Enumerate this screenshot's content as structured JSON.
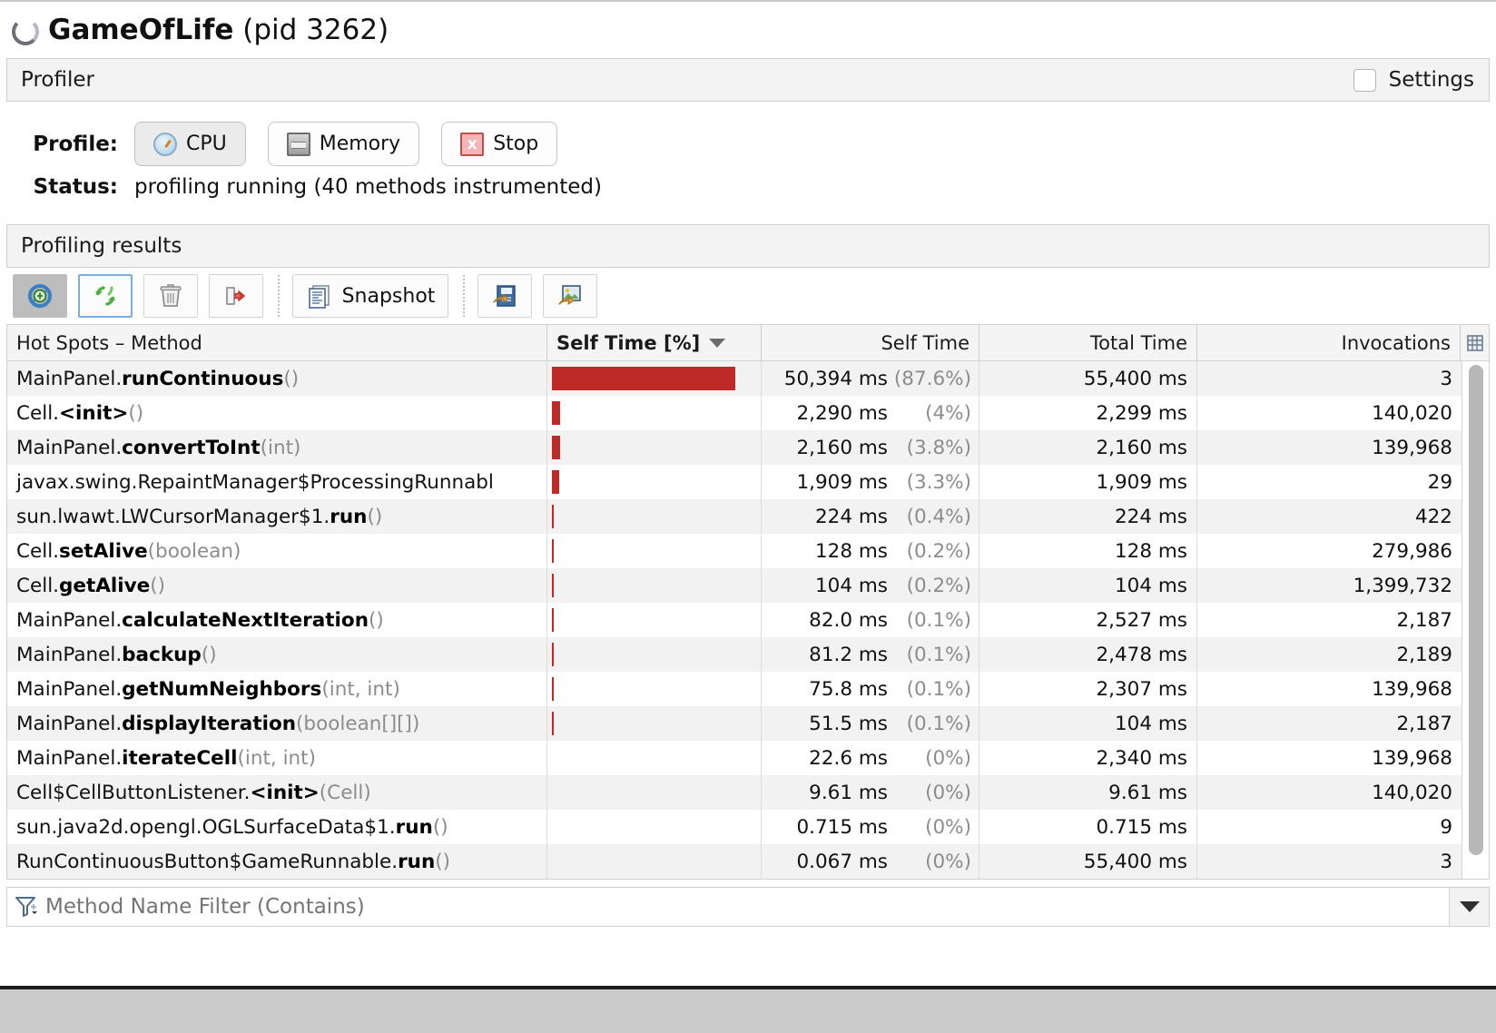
{
  "window": {
    "app_name": "GameOfLife",
    "pid_text": "(pid 3262)",
    "app_icon": "loading-spinner-icon"
  },
  "profiler_header": {
    "title": "Profiler",
    "settings_label": "Settings",
    "settings_checked": false
  },
  "control_panel": {
    "profile_label": "Profile:",
    "buttons": [
      {
        "label": "CPU",
        "icon": "clock-icon",
        "pressed": true
      },
      {
        "label": "Memory",
        "icon": "memory-chip-icon",
        "pressed": false
      },
      {
        "label": "Stop",
        "icon": "stop-red-x-icon",
        "pressed": false
      }
    ],
    "status_label": "Status:",
    "status_value": "profiling running (40 methods instrumented)"
  },
  "results_header": {
    "title": "Profiling results"
  },
  "toolbar": {
    "buttons": [
      {
        "name": "update-results-button",
        "icon": "blue-refresh-icon",
        "label": "",
        "state": "active"
      },
      {
        "name": "auto-refresh-button",
        "icon": "green-recycle-icon",
        "label": "",
        "state": "focused"
      },
      {
        "name": "reset-results-button",
        "icon": "trash-icon",
        "label": "",
        "state": "normal"
      },
      {
        "name": "export-button",
        "icon": "export-red-arrow-icon",
        "label": "",
        "state": "normal"
      },
      {
        "name": "snapshot-button",
        "icon": "snapshot-document-icon",
        "label": "Snapshot",
        "state": "normal"
      },
      {
        "name": "save-report-button",
        "icon": "save-report-icon",
        "label": "",
        "state": "normal"
      },
      {
        "name": "save-image-button",
        "icon": "save-image-icon",
        "label": "",
        "state": "normal"
      }
    ]
  },
  "table": {
    "columns": [
      {
        "key": "method",
        "label": "Hot Spots – Method",
        "sorted": false
      },
      {
        "key": "self_pct",
        "label": "Self Time [%]",
        "sorted": true,
        "sort_dir": "desc"
      },
      {
        "key": "self_time",
        "label": "Self Time",
        "sorted": false
      },
      {
        "key": "total_time",
        "label": "Total Time",
        "sorted": false
      },
      {
        "key": "invocations",
        "label": "Invocations",
        "sorted": false
      }
    ],
    "column_chooser_icon": "column-chooser-icon",
    "bar_color": "#be2a28",
    "rows": [
      {
        "cls": "MainPanel.",
        "mname": "runContinuous",
        "args": "()",
        "pct": 87.6,
        "self": "50,394 ms",
        "self_pct": "(87.6%)",
        "total": "55,400 ms",
        "inv": "3"
      },
      {
        "cls": "Cell.",
        "mname": "<init>",
        "args": "()",
        "pct": 4.0,
        "self": "2,290 ms",
        "self_pct": "(4%)",
        "total": "2,299 ms",
        "inv": "140,020"
      },
      {
        "cls": "MainPanel.",
        "mname": "convertToInt",
        "args": "(int)",
        "pct": 3.8,
        "self": "2,160 ms",
        "self_pct": "(3.8%)",
        "total": "2,160 ms",
        "inv": "139,968"
      },
      {
        "cls": "javax.swing.RepaintManager$ProcessingRunnabl",
        "mname": "",
        "args": "",
        "pct": 3.3,
        "self": "1,909 ms",
        "self_pct": "(3.3%)",
        "total": "1,909 ms",
        "inv": "29"
      },
      {
        "cls": "sun.lwawt.LWCursorManager$1.",
        "mname": "run",
        "args": "()",
        "pct": 0.4,
        "self": "224 ms",
        "self_pct": "(0.4%)",
        "total": "224 ms",
        "inv": "422"
      },
      {
        "cls": "Cell.",
        "mname": "setAlive",
        "args": "(boolean)",
        "pct": 0.2,
        "self": "128 ms",
        "self_pct": "(0.2%)",
        "total": "128 ms",
        "inv": "279,986"
      },
      {
        "cls": "Cell.",
        "mname": "getAlive",
        "args": "()",
        "pct": 0.2,
        "self": "104 ms",
        "self_pct": "(0.2%)",
        "total": "104 ms",
        "inv": "1,399,732"
      },
      {
        "cls": "MainPanel.",
        "mname": "calculateNextIteration",
        "args": "()",
        "pct": 0.1,
        "self": "82.0 ms",
        "self_pct": "(0.1%)",
        "total": "2,527 ms",
        "inv": "2,187"
      },
      {
        "cls": "MainPanel.",
        "mname": "backup",
        "args": "()",
        "pct": 0.1,
        "self": "81.2 ms",
        "self_pct": "(0.1%)",
        "total": "2,478 ms",
        "inv": "2,189"
      },
      {
        "cls": "MainPanel.",
        "mname": "getNumNeighbors",
        "args": "(int, int)",
        "pct": 0.1,
        "self": "75.8 ms",
        "self_pct": "(0.1%)",
        "total": "2,307 ms",
        "inv": "139,968"
      },
      {
        "cls": "MainPanel.",
        "mname": "displayIteration",
        "args": "(boolean[][])",
        "pct": 0.1,
        "self": "51.5 ms",
        "self_pct": "(0.1%)",
        "total": "104 ms",
        "inv": "2,187"
      },
      {
        "cls": "MainPanel.",
        "mname": "iterateCell",
        "args": "(int, int)",
        "pct": 0.0,
        "self": "22.6 ms",
        "self_pct": "(0%)",
        "total": "2,340 ms",
        "inv": "139,968"
      },
      {
        "cls": "Cell$CellButtonListener.",
        "mname": "<init>",
        "args": "(Cell)",
        "pct": 0.0,
        "self": "9.61 ms",
        "self_pct": "(0%)",
        "total": "9.61 ms",
        "inv": "140,020"
      },
      {
        "cls": "sun.java2d.opengl.OGLSurfaceData$1.",
        "mname": "run",
        "args": "()",
        "pct": 0.0,
        "self": "0.715 ms",
        "self_pct": "(0%)",
        "total": "0.715 ms",
        "inv": "9"
      },
      {
        "cls": "RunContinuousButton$GameRunnable.",
        "mname": "run",
        "args": "()",
        "pct": 0.0,
        "self": "0.067 ms",
        "self_pct": "(0%)",
        "total": "55,400 ms",
        "inv": "3"
      }
    ]
  },
  "filter": {
    "icon": "filter-funnel-icon",
    "placeholder": "Method Name Filter (Contains)",
    "value": "",
    "dropdown_icon": "chevron-down-icon"
  }
}
